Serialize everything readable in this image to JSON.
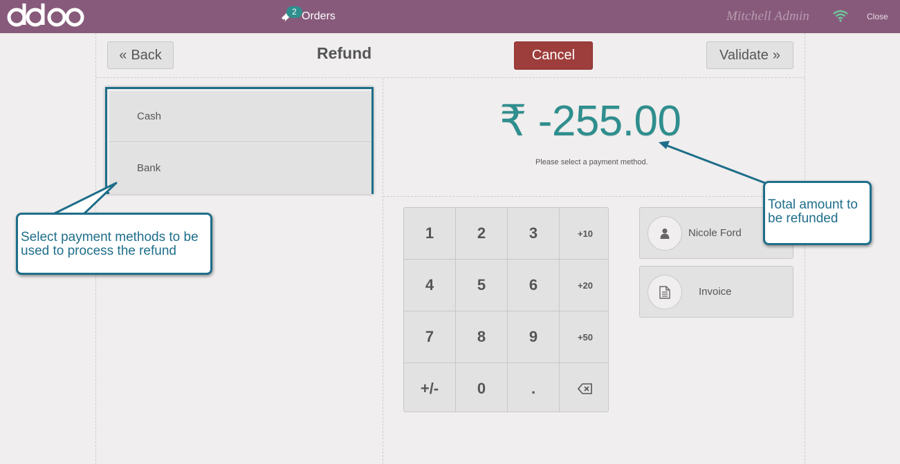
{
  "topbar": {
    "logo_text": "odoo",
    "orders_label": "Orders",
    "orders_count": "2",
    "user_name": "Mitchell Admin",
    "close_label": "Close",
    "bar_color": "#875a7b"
  },
  "header": {
    "back_label": "Back",
    "title": "Refund",
    "cancel_label": "Cancel",
    "validate_label": "Validate"
  },
  "payment_methods": [
    {
      "label": "Cash"
    },
    {
      "label": "Bank"
    }
  ],
  "amount": {
    "currency": "₹",
    "value": "-255.00",
    "hint": "Please select a payment method."
  },
  "numpad": {
    "keys": [
      "1",
      "2",
      "3",
      "+10",
      "4",
      "5",
      "6",
      "+20",
      "7",
      "8",
      "9",
      "+50",
      "+/-",
      "0",
      ".",
      "backspace-icon"
    ]
  },
  "customer": {
    "name": "Nicole Ford"
  },
  "invoice": {
    "label": "Invoice"
  },
  "callouts": {
    "left": "Select payment methods to be used to process the refund",
    "right": "Total amount to be refunded"
  },
  "colors": {
    "accent": "#2f8e8e",
    "cancel": "#9e3e3c",
    "callout": "#1e6e8a"
  }
}
